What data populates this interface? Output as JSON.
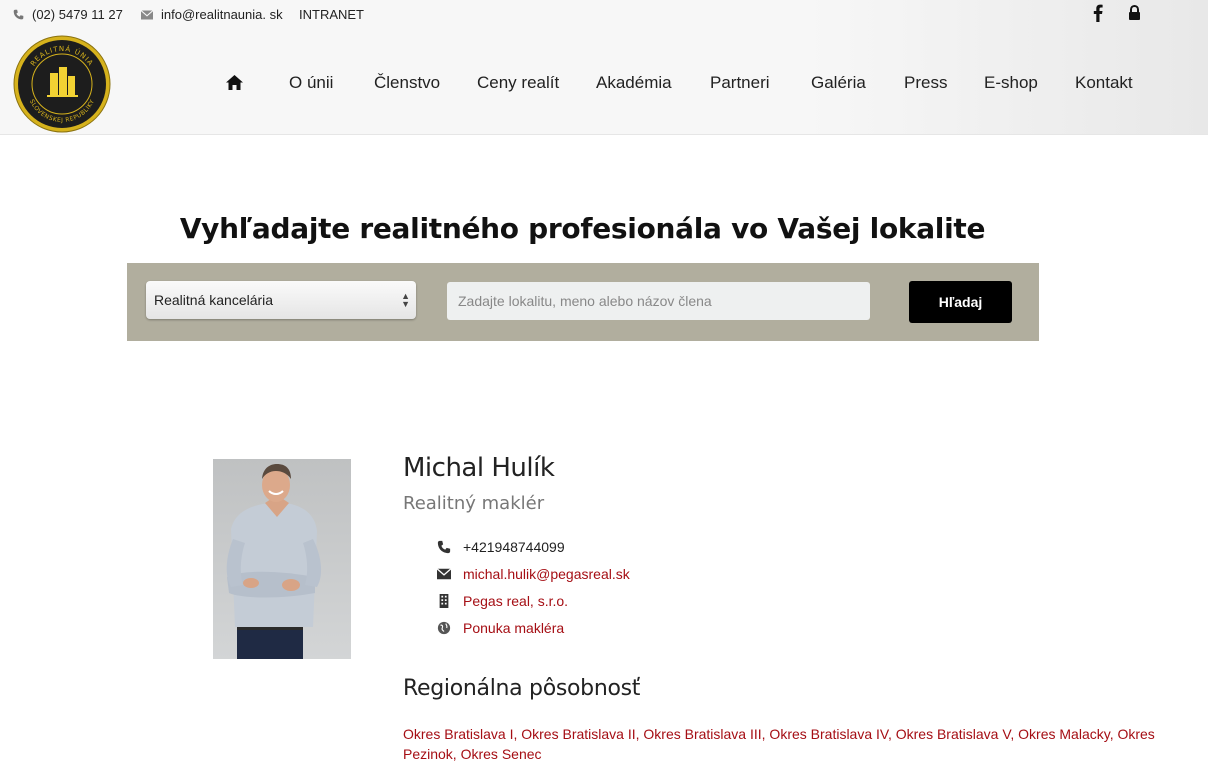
{
  "topbar": {
    "phone": "(02) 5479 11 27",
    "email": "info@realitnaunia. sk",
    "intranet": "INTRANET"
  },
  "icons": {
    "phone": "phone-icon",
    "mail": "mail-icon",
    "facebook": "facebook-icon",
    "lock": "lock-icon",
    "home": "home-icon",
    "building": "building-icon",
    "globe": "globe-icon"
  },
  "nav": {
    "items": [
      {
        "label": "O únii"
      },
      {
        "label": "Členstvo"
      },
      {
        "label": "Ceny realít"
      },
      {
        "label": "Akadémia"
      },
      {
        "label": "Partneri"
      },
      {
        "label": "Galéria"
      },
      {
        "label": "Press"
      },
      {
        "label": "E-shop"
      },
      {
        "label": "Kontakt"
      }
    ]
  },
  "logo": {
    "text_top": "REALITNÁ ÚNIA",
    "text_bottom": "SLOVENSKEJ REPUBLIKY"
  },
  "search": {
    "title": "Vyhľadajte realitného profesionála vo Vašej lokalite",
    "select_value": "Realitná kancelária",
    "placeholder": "Zadajte lokalitu, meno alebo názov člena",
    "button": "Hľadaj"
  },
  "profile": {
    "name": "Michal Hulík",
    "role": "Realitný maklér",
    "phone": "+421948744099",
    "email": "michal.hulik@pegasreal.sk",
    "company": "Pegas real, s.r.o.",
    "offer": "Ponuka makléra",
    "region_title": "Regionálna pôsobnosť",
    "regions": "Okres Bratislava I, Okres Bratislava II, Okres Bratislava III, Okres Bratislava IV, Okres Bratislava V, Okres Malacky, Okres Pezinok, Okres Senec"
  },
  "colors": {
    "accent": "#a50e14",
    "band": "#b1ae9e",
    "logo_gold": "#d6b21c"
  }
}
